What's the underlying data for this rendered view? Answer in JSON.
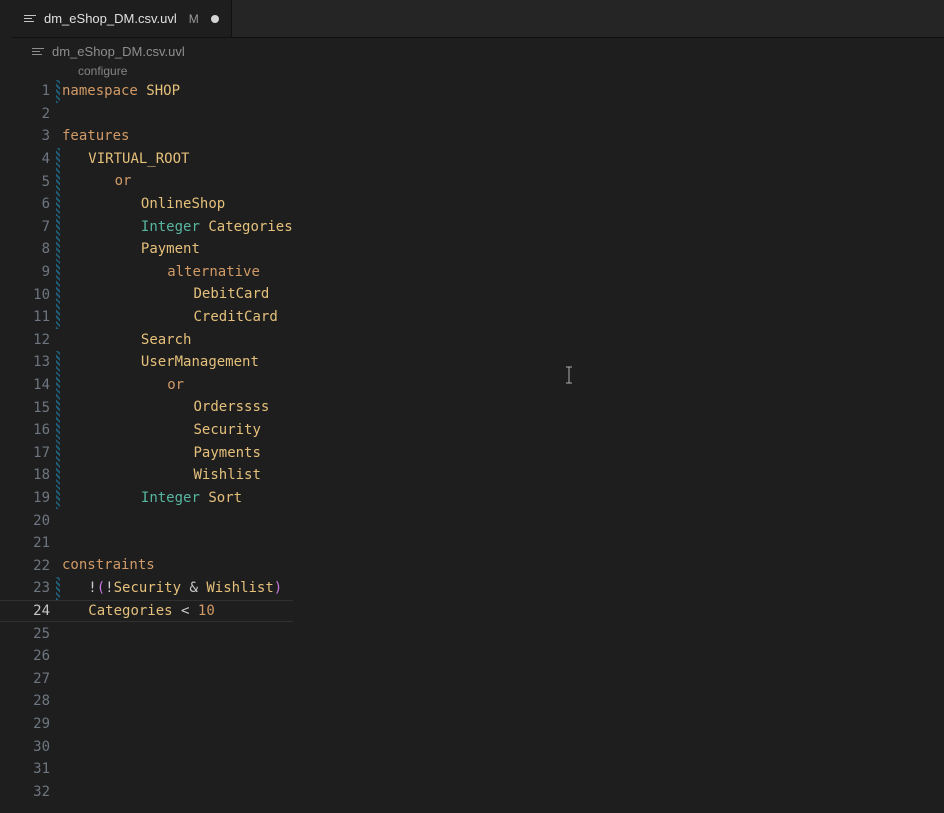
{
  "tab": {
    "title": "dm_eShop_DM.csv.uvl",
    "modified_indicator": "M"
  },
  "breadcrumb": {
    "text": "dm_eShop_DM.csv.uvl"
  },
  "codelens": {
    "configure": "configure"
  },
  "code_tokens": {
    "namespace": "namespace",
    "shop": "SHOP",
    "features": "features",
    "virtual_root": "VIRTUAL_ROOT",
    "or": "or",
    "onlineshop": "OnlineShop",
    "integer": "Integer",
    "categories": "Categories",
    "payment": "Payment",
    "alternative": "alternative",
    "debitcard": "DebitCard",
    "creditcard": "CreditCard",
    "search": "Search",
    "usermanagement": "UserManagement",
    "ordersss": "Orderssss",
    "security": "Security",
    "payments": "Payments",
    "wishlist": "Wishlist",
    "sort": "Sort",
    "constraints": "constraints",
    "bang": "!",
    "lparen": "(",
    "rparen": ")",
    "amp": "&",
    "lt": "<",
    "ten": "10"
  },
  "line_numbers": [
    "1",
    "2",
    "3",
    "4",
    "5",
    "6",
    "7",
    "8",
    "9",
    "10",
    "11",
    "12",
    "13",
    "14",
    "15",
    "16",
    "17",
    "18",
    "19",
    "20",
    "21",
    "22",
    "23",
    "24",
    "25",
    "26",
    "27",
    "28",
    "29",
    "30",
    "31",
    "32"
  ],
  "diff_modified_lines": [
    1,
    4,
    5,
    6,
    7,
    8,
    9,
    10,
    11,
    13,
    14,
    15,
    16,
    17,
    18,
    19,
    23
  ],
  "current_line": 24
}
